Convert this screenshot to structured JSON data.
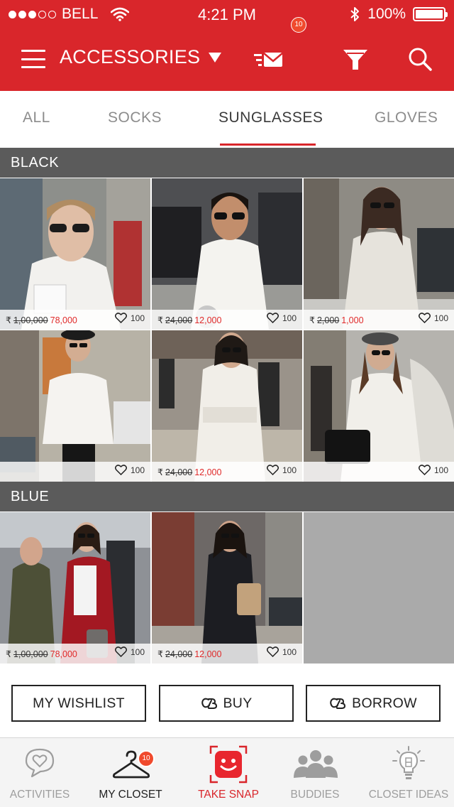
{
  "status_bar": {
    "carrier": "BELL",
    "time": "4:21 PM",
    "battery": "100%",
    "signal_bars": 3,
    "signal_total": 5
  },
  "navbar": {
    "title": "ACCESSORIES",
    "mail_badge": "10",
    "icons": [
      "menu-icon",
      "mail-icon",
      "filter-icon",
      "search-icon"
    ]
  },
  "tabs": [
    {
      "label": "ALL",
      "active": false
    },
    {
      "label": "SOCKS",
      "active": false
    },
    {
      "label": "SUNGLASSES",
      "active": true
    },
    {
      "label": "GLOVES",
      "active": false
    }
  ],
  "sections": [
    {
      "title": "BLACK",
      "items": [
        {
          "currency": "₹",
          "old_price": "1,00,000",
          "new_price": "78,000",
          "likes": "100"
        },
        {
          "currency": "₹",
          "old_price": "24,000",
          "new_price": "12,000",
          "likes": "100"
        },
        {
          "currency": "₹",
          "old_price": "2,000",
          "new_price": "1,000",
          "likes": "100"
        },
        {
          "currency": "",
          "old_price": "",
          "new_price": "",
          "likes": "100"
        },
        {
          "currency": "₹",
          "old_price": "24,000",
          "new_price": "12,000",
          "likes": "100"
        },
        {
          "currency": "",
          "old_price": "",
          "new_price": "",
          "likes": "100"
        }
      ]
    },
    {
      "title": "BLUE",
      "items": [
        {
          "currency": "₹",
          "old_price": "1,00,000",
          "new_price": "78,000",
          "likes": "100"
        },
        {
          "currency": "₹",
          "old_price": "24,000",
          "new_price": "12,000",
          "likes": "100"
        }
      ]
    }
  ],
  "actions": {
    "wishlist": "MY WISHLIST",
    "buy": "BUY",
    "borrow": "BORROW"
  },
  "tabbar": {
    "activities": "ACTIVITIES",
    "closet": "MY CLOSET",
    "closet_badge": "10",
    "snap": "TAKE SNAP",
    "buddies": "BUDDIES",
    "ideas": "CLOSET IDEAS"
  },
  "colors": {
    "brand_red": "#d9262b",
    "badge": "#f04a2d",
    "sale_price": "#e02a2a",
    "section_header": "#5b5b5b"
  }
}
